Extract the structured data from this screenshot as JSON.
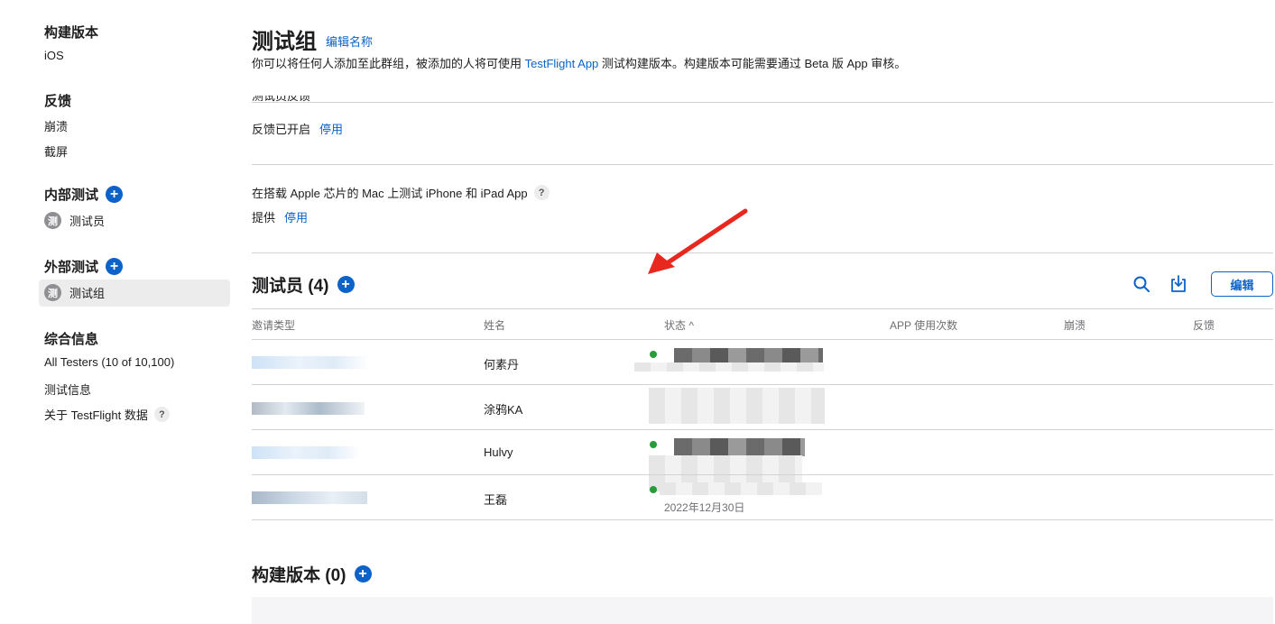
{
  "sidebar": {
    "build": {
      "title": "构建版本",
      "items": [
        "iOS"
      ]
    },
    "feedback": {
      "title": "反馈",
      "items": [
        "崩溃",
        "截屏"
      ]
    },
    "internal": {
      "title": "内部测试",
      "items": [
        {
          "avatar": "测",
          "label": "测试员"
        }
      ]
    },
    "external": {
      "title": "外部测试",
      "items": [
        {
          "avatar": "测",
          "label": "测试组"
        }
      ]
    },
    "general": {
      "title": "综合信息",
      "items": [
        "All Testers (10 of 10,100)",
        "测试信息",
        "关于 TestFlight 数据"
      ],
      "help": "?"
    }
  },
  "header": {
    "title": "测试组",
    "edit_name": "编辑名称",
    "desc_before": "你可以将任何人添加至此群组，被添加的人将可使用 ",
    "desc_link": "TestFlight App",
    "desc_after": " 测试构建版本。构建版本可能需要通过 Beta 版 App 审核。"
  },
  "feedback_setting": {
    "label_cut": "测试员反馈",
    "status": "反馈已开启",
    "action": "停用"
  },
  "mac_setting": {
    "label": "在搭载 Apple 芯片的 Mac 上测试 iPhone 和 iPad App",
    "help": "?",
    "status": "提供",
    "action": "停用"
  },
  "testers": {
    "title": "测试员 (4)",
    "edit_label": "编辑",
    "columns": [
      "邀请类型",
      "姓名",
      "状态 ^",
      "APP 使用次数",
      "崩溃",
      "反馈"
    ],
    "rows": [
      {
        "name": "何素丹",
        "date": ""
      },
      {
        "name": "涂鸦KA",
        "date": ""
      },
      {
        "name": "Hulvy",
        "date": ""
      },
      {
        "name": "王磊",
        "date": "2022年12月30日"
      }
    ]
  },
  "builds": {
    "title": "构建版本 (0)"
  },
  "icons": {
    "plus": "plus-circle-icon",
    "search": "search-icon",
    "download": "download-icon",
    "help": "question-mark-icon"
  },
  "colors": {
    "accent": "#0b63c9",
    "annotation_arrow": "#e8281e",
    "status_green": "#2b9a3c"
  }
}
